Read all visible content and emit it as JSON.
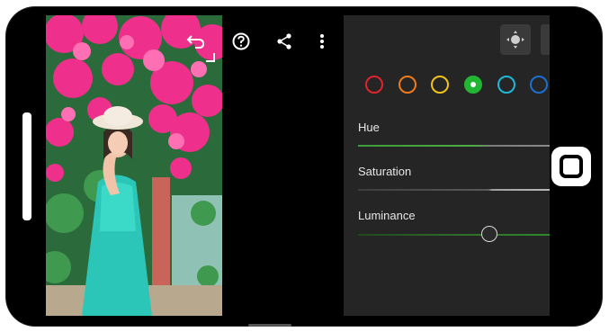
{
  "toolbar": {
    "undo_icon": "undo-icon",
    "help_icon": "help-icon",
    "share_icon": "share-icon",
    "more_icon": "more-vertical-icon",
    "target_icon": "targeted-adjustment-icon"
  },
  "color_swatches": [
    {
      "name": "red",
      "color": "#e0242e",
      "selected": false
    },
    {
      "name": "orange",
      "color": "#f07a1a",
      "selected": false
    },
    {
      "name": "yellow",
      "color": "#f2c21a",
      "selected": false
    },
    {
      "name": "green",
      "color": "#22b532",
      "selected": true
    },
    {
      "name": "aqua",
      "color": "#1fb7d8",
      "selected": false
    },
    {
      "name": "blue",
      "color": "#1b6fd1",
      "selected": false
    }
  ],
  "sliders": [
    {
      "label": "Hue",
      "value": 0.69
    },
    {
      "label": "Saturation",
      "value": 0.69
    },
    {
      "label": "Luminance",
      "value": 0.69
    }
  ]
}
